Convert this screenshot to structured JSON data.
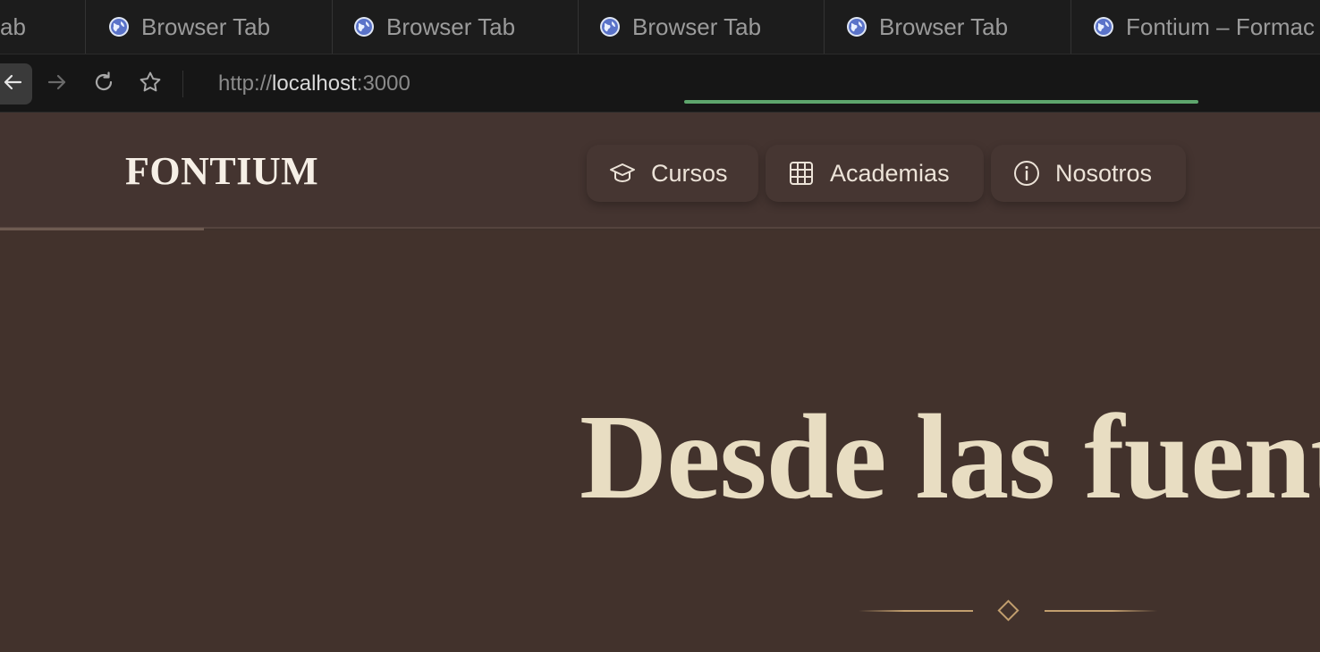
{
  "browser": {
    "tabs": [
      {
        "label": "Browser Tab",
        "partial_label": "ab",
        "icon": "globe-icon"
      },
      {
        "label": "Browser Tab",
        "icon": "globe-icon"
      },
      {
        "label": "Browser Tab",
        "icon": "globe-icon"
      },
      {
        "label": "Browser Tab",
        "icon": "globe-icon"
      },
      {
        "label": "Browser Tab",
        "icon": "globe-icon"
      },
      {
        "label": "Fontium – Formac",
        "icon": "globe-icon",
        "active": true
      }
    ],
    "url": {
      "scheme": "http://",
      "host": "localhost",
      "port": ":3000"
    },
    "load_color": "#5ea66d"
  },
  "site": {
    "logo": "FONTIUM",
    "nav": [
      {
        "label": "Cursos",
        "icon": "graduation-cap-icon"
      },
      {
        "label": "Academias",
        "icon": "grid-icon"
      },
      {
        "label": "Nosotros",
        "icon": "info-icon"
      }
    ],
    "hero_title": "Desde las fuent",
    "colors": {
      "background": "#42322c",
      "title": "#e8ddc2",
      "accent": "#c19e6e"
    }
  }
}
